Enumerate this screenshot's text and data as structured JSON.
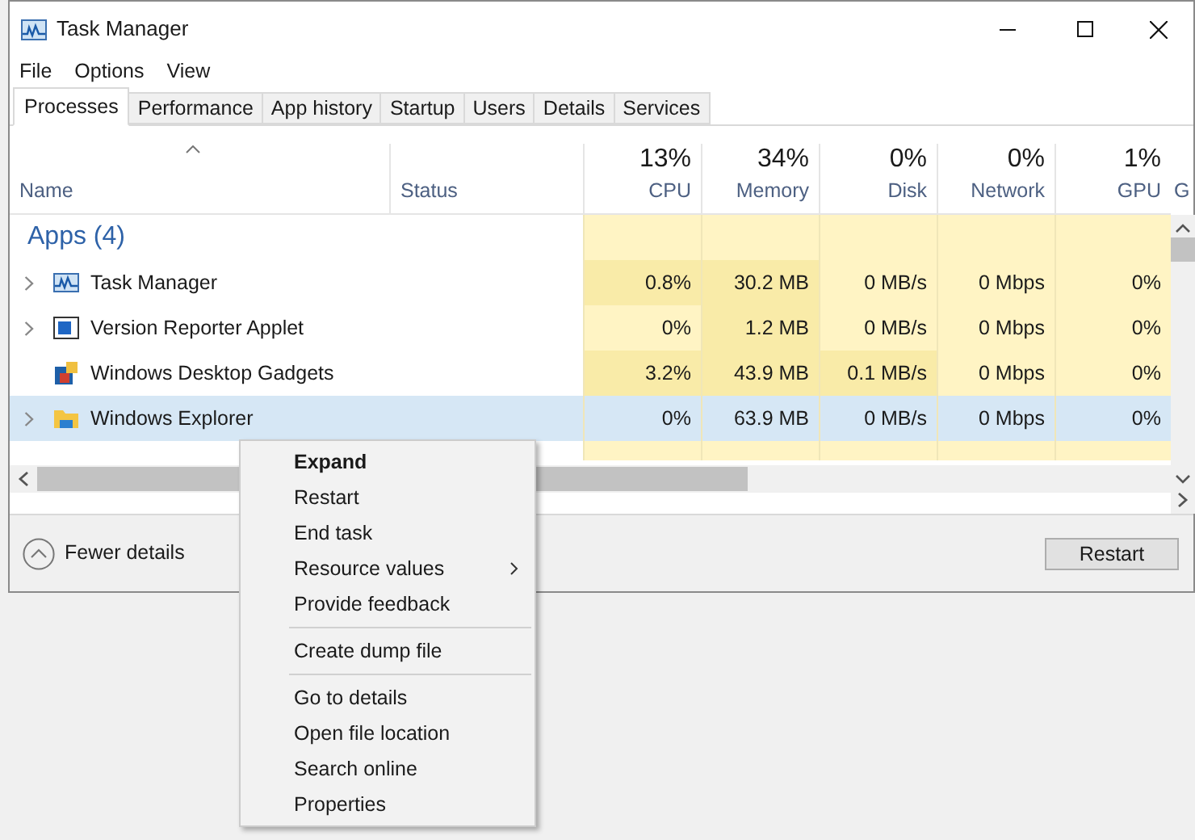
{
  "window": {
    "title": "Task Manager"
  },
  "menu": [
    "File",
    "Options",
    "View"
  ],
  "tabs": [
    {
      "label": "Processes",
      "selected": true
    },
    {
      "label": "Performance",
      "selected": false
    },
    {
      "label": "App history",
      "selected": false
    },
    {
      "label": "Startup",
      "selected": false
    },
    {
      "label": "Users",
      "selected": false
    },
    {
      "label": "Details",
      "selected": false
    },
    {
      "label": "Services",
      "selected": false
    }
  ],
  "columns": [
    {
      "label": "Name"
    },
    {
      "label": "Status"
    },
    {
      "label": "CPU",
      "total": "13%"
    },
    {
      "label": "Memory",
      "total": "34%"
    },
    {
      "label": "Disk",
      "total": "0%"
    },
    {
      "label": "Network",
      "total": "0%"
    },
    {
      "label": "GPU",
      "total": "1%"
    },
    {
      "label": "G"
    }
  ],
  "group": {
    "label": "Apps (4)"
  },
  "rows": [
    {
      "name": "Task Manager",
      "expandable": true,
      "selected": false,
      "cells": [
        {
          "text": "0.8%",
          "color": "#f9eba8"
        },
        {
          "text": "30.2 MB",
          "color": "#f9eba8"
        },
        {
          "text": "0 MB/s",
          "color": "#fff4c4"
        },
        {
          "text": "0 Mbps",
          "color": "#fff4c4"
        },
        {
          "text": "0%",
          "color": "#fff4c4"
        }
      ]
    },
    {
      "name": "Version Reporter Applet",
      "expandable": true,
      "selected": false,
      "cells": [
        {
          "text": "0%",
          "color": "#fff4c4"
        },
        {
          "text": "1.2 MB",
          "color": "#f9eba8"
        },
        {
          "text": "0 MB/s",
          "color": "#fff4c4"
        },
        {
          "text": "0 Mbps",
          "color": "#fff4c4"
        },
        {
          "text": "0%",
          "color": "#fff4c4"
        }
      ]
    },
    {
      "name": "Windows Desktop Gadgets",
      "expandable": false,
      "selected": false,
      "cells": [
        {
          "text": "3.2%",
          "color": "#f9eba8"
        },
        {
          "text": "43.9 MB",
          "color": "#f9eba8"
        },
        {
          "text": "0.1 MB/s",
          "color": "#f9eba8"
        },
        {
          "text": "0 Mbps",
          "color": "#fff4c4"
        },
        {
          "text": "0%",
          "color": "#fff4c4"
        }
      ]
    },
    {
      "name": "Windows Explorer",
      "expandable": true,
      "selected": true,
      "cells": [
        {
          "text": "0%"
        },
        {
          "text": "63.9 MB"
        },
        {
          "text": "0 MB/s"
        },
        {
          "text": "0 Mbps"
        },
        {
          "text": "0%"
        }
      ]
    }
  ],
  "footer": {
    "fewer_details": "Fewer details",
    "button": "Restart"
  },
  "context_menu": [
    {
      "kind": "item",
      "label": "Expand",
      "bold": true,
      "submenu": false
    },
    {
      "kind": "item",
      "label": "Restart",
      "bold": false,
      "submenu": false
    },
    {
      "kind": "item",
      "label": "End task",
      "bold": false,
      "submenu": false
    },
    {
      "kind": "item",
      "label": "Resource values",
      "bold": false,
      "submenu": true
    },
    {
      "kind": "item",
      "label": "Provide feedback",
      "bold": false,
      "submenu": false
    },
    {
      "kind": "separator"
    },
    {
      "kind": "item",
      "label": "Create dump file",
      "bold": false,
      "submenu": false
    },
    {
      "kind": "separator"
    },
    {
      "kind": "item",
      "label": "Go to details",
      "bold": false,
      "submenu": false
    },
    {
      "kind": "item",
      "label": "Open file location",
      "bold": false,
      "submenu": false
    },
    {
      "kind": "item",
      "label": "Search online",
      "bold": false,
      "submenu": false
    },
    {
      "kind": "item",
      "label": "Properties",
      "bold": false,
      "submenu": false
    }
  ]
}
